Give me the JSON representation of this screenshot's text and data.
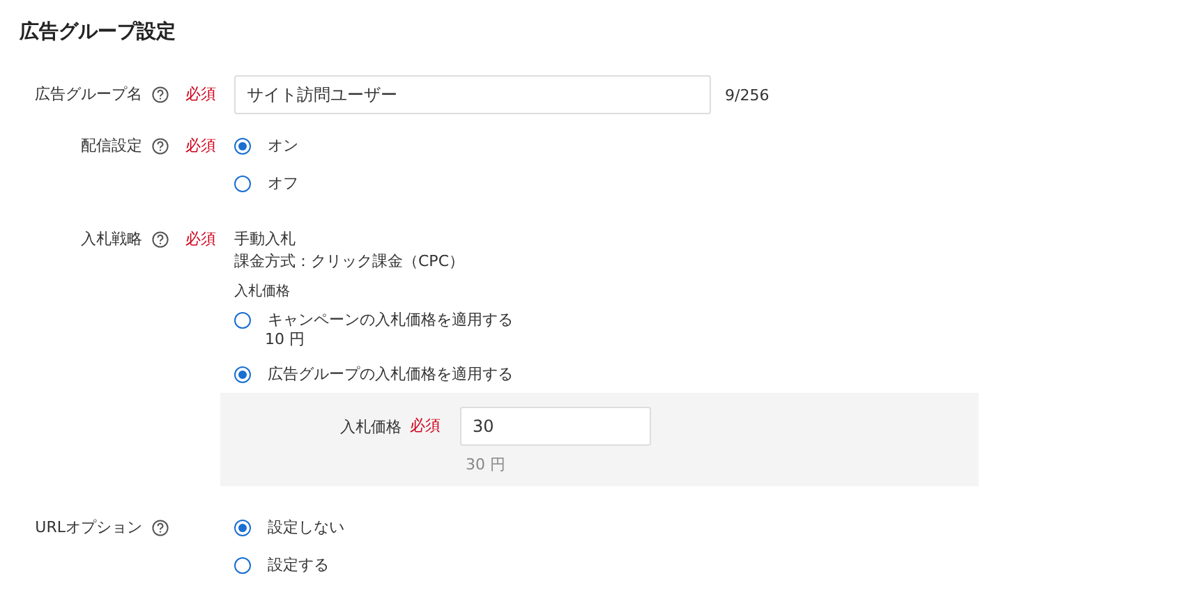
{
  "title": "広告グループ設定",
  "fields": [
    {
      "kind": "text",
      "label": "広告グループ名",
      "required_label": "必須",
      "value": "サイト訪問ユーザー",
      "counter": "9/256"
    },
    {
      "kind": "radio",
      "label": "配信設定",
      "required_label": "必須",
      "options": [
        {
          "label": "オン",
          "selected": true
        },
        {
          "label": "オフ",
          "selected": false
        }
      ]
    },
    {
      "kind": "bid",
      "label": "入札戦略",
      "required_label": "必須",
      "lines": [
        "手動入札",
        "課金方式：クリック課金（CPC）"
      ],
      "price_heading": "入札価格",
      "options": [
        {
          "label": "キャンペーンの入札価格を適用する",
          "note": "10 円",
          "selected": false
        },
        {
          "label": "広告グループの入札価格を適用する",
          "selected": true
        }
      ],
      "panel": {
        "label": "入札価格",
        "required_label": "必須",
        "value": "30",
        "note": "30 円"
      }
    },
    {
      "kind": "radio",
      "label": "URLオプション",
      "options": [
        {
          "label": "設定しない",
          "selected": true
        },
        {
          "label": "設定する",
          "selected": false
        }
      ]
    }
  ]
}
